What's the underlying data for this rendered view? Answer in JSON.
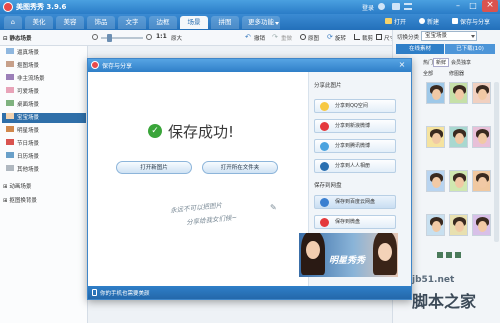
{
  "app": {
    "title": "美图秀秀 3.9.6",
    "user": "登录"
  },
  "window_controls": {
    "minimize": "–",
    "maximize": "□",
    "close": "×"
  },
  "tabs": [
    {
      "label": "⌂",
      "active": false
    },
    {
      "label": "美化",
      "active": false
    },
    {
      "label": "美容",
      "active": false
    },
    {
      "label": "饰品",
      "active": false
    },
    {
      "label": "文字",
      "active": false
    },
    {
      "label": "边框",
      "active": false
    },
    {
      "label": "场景",
      "active": true
    },
    {
      "label": "拼图",
      "active": false
    },
    {
      "label": "更多功能",
      "active": false
    }
  ],
  "top_actions": {
    "open": "打开",
    "new": "新建",
    "save_share": "保存与分享"
  },
  "toolbar": {
    "zoom_ratio": "1:1",
    "original_size": "原大",
    "undo": "撤销",
    "redo": "重做",
    "original": "原图",
    "rotate": "旋转",
    "crop": "裁剪",
    "size": "尺寸"
  },
  "sidebar": {
    "items": [
      {
        "label": "静态场景",
        "type": "header"
      },
      {
        "label": "逼真场景",
        "type": "item"
      },
      {
        "label": "抠图场景",
        "type": "item"
      },
      {
        "label": "非主流场景",
        "type": "item"
      },
      {
        "label": "可爱场景",
        "type": "item"
      },
      {
        "label": "桌面场景",
        "type": "item"
      },
      {
        "label": "宝宝场景",
        "type": "item",
        "selected": true
      },
      {
        "label": "明星场景",
        "type": "item"
      },
      {
        "label": "节日场景",
        "type": "item"
      },
      {
        "label": "日历场景",
        "type": "item"
      },
      {
        "label": "其他场景",
        "type": "item"
      },
      {
        "label": "动画场景",
        "type": "header"
      },
      {
        "label": "抠图换背景",
        "type": "header"
      }
    ]
  },
  "right_panel": {
    "category_label": "切换分类",
    "category_value": "宝宝场景",
    "tabs": [
      "在线素材",
      "已下载(10)"
    ],
    "subtabs": [
      "热门",
      "新鲜",
      "会员独享"
    ],
    "tags": [
      "全部",
      "修图器"
    ]
  },
  "dialog": {
    "title": "保存与分享",
    "success_text": "保存成功!",
    "open_new_button": "打开新图片",
    "open_folder_button": "打开所在文件夹",
    "handwriting_line1": "永远不可以把图片",
    "handwriting_line2": "分享给我女们候~",
    "share_section": "分享此图片",
    "share_items": [
      "分享到QQ空间",
      "分享到新浪微博",
      "分享到腾讯微博",
      "分享到人人相册"
    ],
    "cloud_section": "保存到网盘",
    "cloud_items": [
      "保存到百度云网盘",
      "保存到微盘"
    ],
    "ad_text": "明星秀秀",
    "footer_text": "你的手机也需要美颜"
  },
  "watermark": {
    "line1": "jb51.net",
    "line2": "脚本之家"
  },
  "colors": {
    "brand_blue": "#2a7cc7",
    "success_green": "#3aa53a",
    "selected_bg": "#2f6fa9"
  }
}
